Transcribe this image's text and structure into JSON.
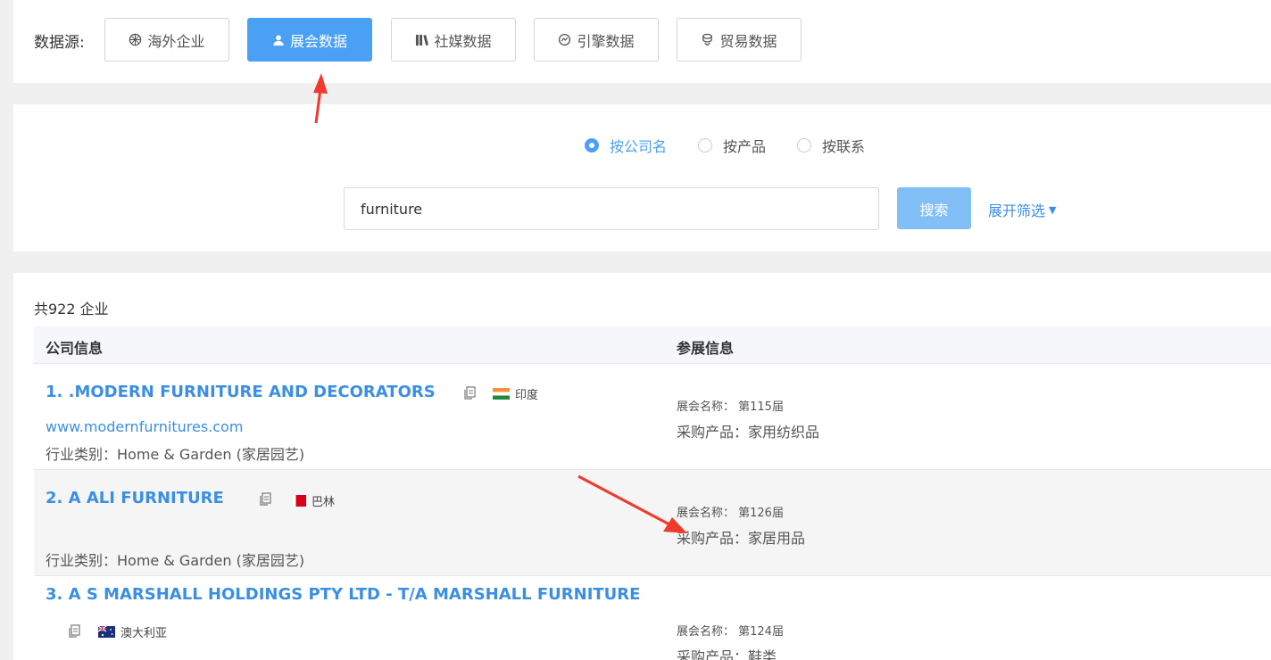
{
  "source": {
    "label": "数据源:",
    "buttons": [
      {
        "label": "海外企业",
        "icon": "globe-icon",
        "active": false
      },
      {
        "label": "展会数据",
        "icon": "user-icon",
        "active": true
      },
      {
        "label": "社媒数据",
        "icon": "books-icon",
        "active": false
      },
      {
        "label": "引擎数据",
        "icon": "search-engine-icon",
        "active": false
      },
      {
        "label": "贸易数据",
        "icon": "trade-icon",
        "active": false
      }
    ]
  },
  "search": {
    "modes": [
      {
        "label": "按公司名",
        "checked": true
      },
      {
        "label": "按产品",
        "checked": false
      },
      {
        "label": "按联系",
        "checked": false
      }
    ],
    "query": "furniture",
    "button": "搜索",
    "expand": "展开筛选"
  },
  "results": {
    "count": "共922 企业",
    "headers": {
      "company": "公司信息",
      "exhibition": "参展信息"
    },
    "rows": [
      {
        "name": "1. .MODERN FURNITURE AND DECORATORS",
        "country": "印度",
        "website": "www.modernfurnitures.com",
        "industry": "行业类别：Home & Garden (家居园艺)",
        "fair": "展会名称：  第115届",
        "product": "采购产品：家用纺织品"
      },
      {
        "name": "2. A ALI FURNITURE",
        "country": "巴林",
        "website": "",
        "industry": "行业类别：Home & Garden (家居园艺)",
        "fair": "展会名称：  第126届",
        "product": "采购产品：家居用品"
      },
      {
        "name": "3. A S MARSHALL HOLDINGS PTY LTD - T/A MARSHALL FURNITURE",
        "country": "澳大利亚",
        "website": "",
        "industry": "",
        "fair": "展会名称：  第124届",
        "product": "采购产品：鞋类"
      }
    ]
  },
  "colors": {
    "accent": "#4aa0f5",
    "link": "#3b8fe3",
    "annotation": "#f03a2e"
  }
}
